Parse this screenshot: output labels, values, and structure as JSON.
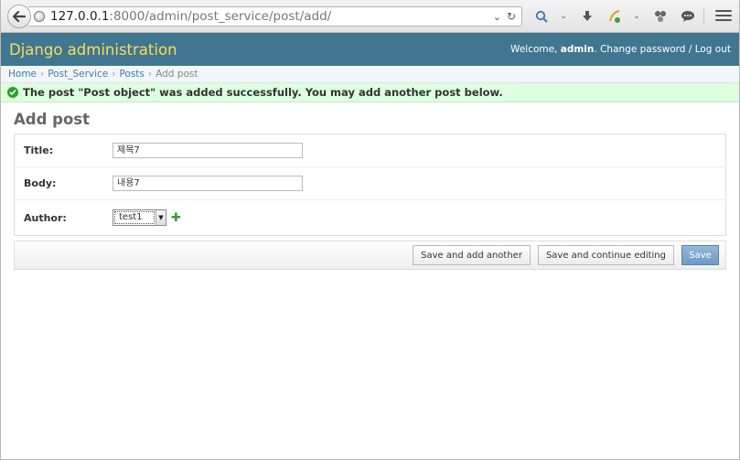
{
  "browser": {
    "url_host": "127.0.0.1",
    "url_rest": ":8000/admin/post_service/post/add/"
  },
  "header": {
    "brand": "Django administration",
    "welcome": "Welcome,",
    "user": "admin",
    "change_password": "Change password",
    "separator": "/",
    "logout": "Log out"
  },
  "breadcrumbs": {
    "items": [
      "Home",
      "Post_Service",
      "Posts"
    ],
    "current": "Add post",
    "sep": "›"
  },
  "message": {
    "text": "The post \"Post object\" was added successfully. You may add another post below."
  },
  "form": {
    "title": "Add post",
    "fields": {
      "title": {
        "label": "Title:",
        "value": "제목7"
      },
      "body": {
        "label": "Body:",
        "value": "내용7"
      },
      "author": {
        "label": "Author:",
        "value": "test1"
      }
    }
  },
  "buttons": {
    "save_add_another": "Save and add another",
    "save_continue": "Save and continue editing",
    "save": "Save"
  }
}
